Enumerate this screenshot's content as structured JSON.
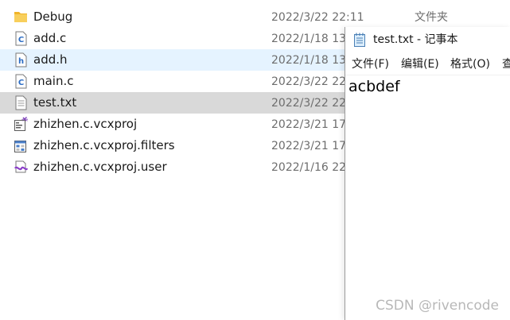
{
  "explorer": {
    "files": [
      {
        "name": "Debug",
        "date": "2022/3/22 22:11",
        "type": "文件夹",
        "icon": "folder-icon"
      },
      {
        "name": "add.c",
        "date": "2022/1/18 13",
        "type": "",
        "icon": "c-source-file-icon"
      },
      {
        "name": "add.h",
        "date": "2022/1/18 13",
        "type": "",
        "icon": "h-header-file-icon"
      },
      {
        "name": "main.c",
        "date": "2022/3/22 22",
        "type": "",
        "icon": "c-source-file-icon"
      },
      {
        "name": "test.txt",
        "date": "2022/3/22 22",
        "type": "",
        "icon": "text-file-icon"
      },
      {
        "name": "zhizhen.c.vcxproj",
        "date": "2022/3/21 17",
        "type": "",
        "icon": "vcxproj-file-icon"
      },
      {
        "name": "zhizhen.c.vcxproj.filters",
        "date": "2022/3/21 17",
        "type": "",
        "icon": "vcxproj-filters-file-icon"
      },
      {
        "name": "zhizhen.c.vcxproj.user",
        "date": "2022/1/16 22",
        "type": "",
        "icon": "vcxproj-user-file-icon"
      }
    ]
  },
  "notepad": {
    "title": "test.txt - 记事本",
    "icon": "notepad-icon",
    "menu": [
      "文件(F)",
      "编辑(E)",
      "格式(O)",
      "查"
    ],
    "content": "acbdef"
  },
  "watermark": "CSDN @rivencode",
  "colors": {
    "hover_row": "#e5f3ff",
    "selected_row": "#d9d9d9",
    "folder": "#f5c542",
    "c_file_blue": "#2b6cc4"
  }
}
